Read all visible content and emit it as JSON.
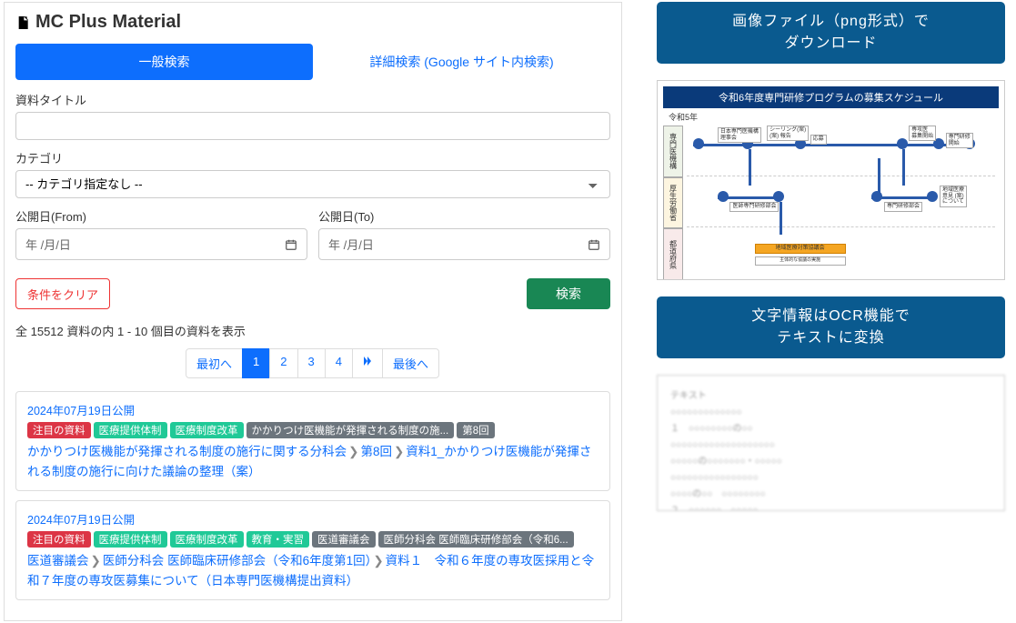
{
  "page_title": "MC Plus Material",
  "tabs": {
    "general": "一般検索",
    "detail": "詳細検索 (Google サイト内検索)"
  },
  "form": {
    "title_label": "資料タイトル",
    "category_label": "カテゴリ",
    "category_placeholder": "-- カテゴリ指定なし --",
    "date_from_label": "公開日(From)",
    "date_to_label": "公開日(To)",
    "date_placeholder": "年 /月/日",
    "clear_btn": "条件をクリア",
    "search_btn": "検索"
  },
  "results": {
    "count_text": "全 15512 資料の内 1 - 10 個目の資料を表示"
  },
  "pager": {
    "first": "最初へ",
    "pages": [
      "1",
      "2",
      "3",
      "4"
    ],
    "last": "最後へ"
  },
  "items": [
    {
      "date": "2024年07月19日公開",
      "tags": [
        {
          "label": "注目の資料",
          "cls": "red"
        },
        {
          "label": "医療提供体制",
          "cls": "teal"
        },
        {
          "label": "医療制度改革",
          "cls": "teal"
        },
        {
          "label": "かかりつけ医機能が発揮される制度の施...",
          "cls": "gray"
        },
        {
          "label": "第8回",
          "cls": "gray"
        }
      ],
      "crumbs": [
        "かかりつけ医機能が発揮される制度の施行に関する分科会",
        "第8回",
        "資料1_かかりつけ医機能が発揮される制度の施行に向けた議論の整理（案）"
      ]
    },
    {
      "date": "2024年07月19日公開",
      "tags": [
        {
          "label": "注目の資料",
          "cls": "red"
        },
        {
          "label": "医療提供体制",
          "cls": "teal"
        },
        {
          "label": "医療制度改革",
          "cls": "teal"
        },
        {
          "label": "教育・実習",
          "cls": "teal"
        },
        {
          "label": "医道審議会",
          "cls": "gray"
        },
        {
          "label": "医師分科会 医師臨床研修部会（令和6...",
          "cls": "gray"
        }
      ],
      "crumbs": [
        "医道審議会",
        "医師分科会 医師臨床研修部会（令和6年度第1回）",
        "資料１　令和６年度の専攻医採用と令和７年度の専攻医募集について（日本専門医機構提出資料）"
      ]
    }
  ],
  "right": {
    "banner1_l1": "画像ファイル（png形式）で",
    "banner1_l2": "ダウンロード",
    "banner2_l1": "文字情報はOCR機能で",
    "banner2_l2": "テキストに変換",
    "chart_title": "令和6年度専門研修プログラムの募集スケジュール",
    "chart_sub": "令和5年",
    "lanes": [
      "専門医機構",
      "厚生労働省",
      "都道府県"
    ]
  }
}
